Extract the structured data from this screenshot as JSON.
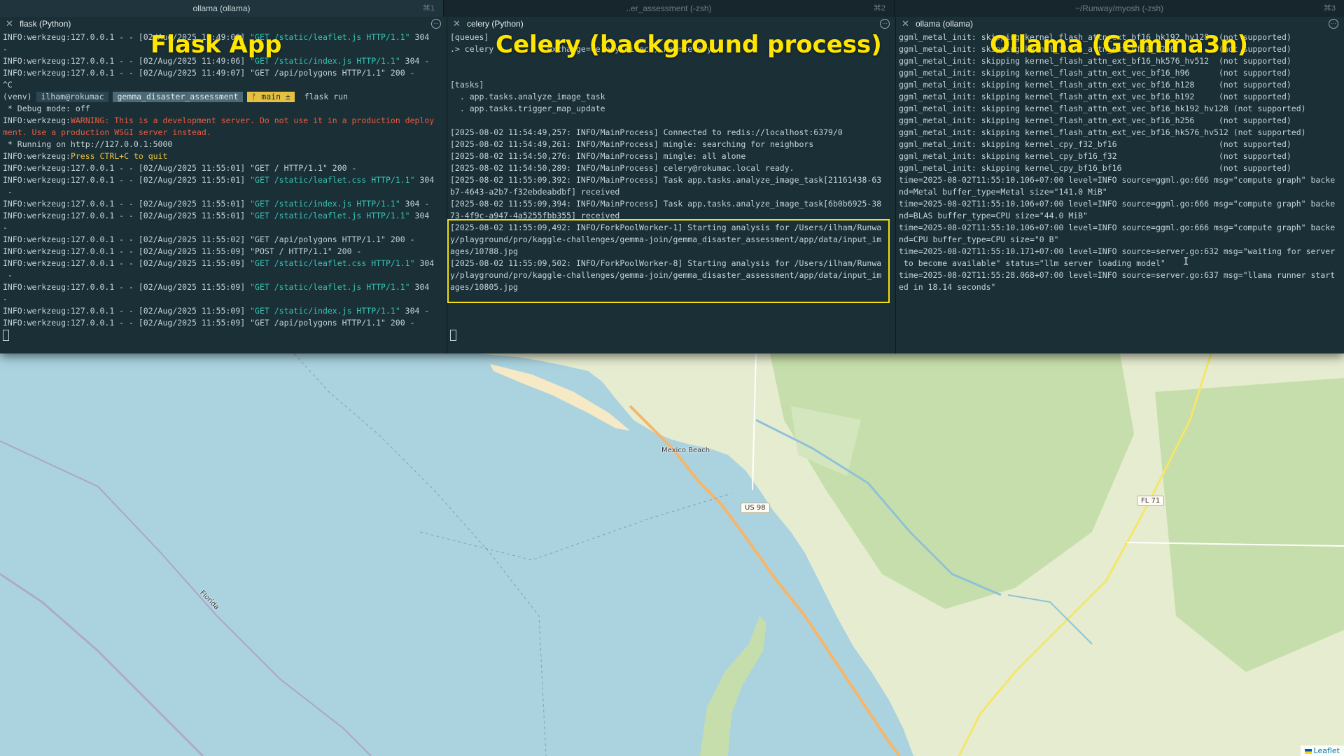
{
  "tabs": [
    {
      "title": "ollama (ollama)",
      "shortcut": "⌘1",
      "active": true
    },
    {
      "title": "..er_assessment (-zsh)",
      "shortcut": "⌘2",
      "active": false
    },
    {
      "title": "~/Runway/myosh (-zsh)",
      "shortcut": "⌘3",
      "active": false
    }
  ],
  "panes": {
    "flask": {
      "header": "flask (Python)",
      "overlay_title": "Flask App",
      "lines": [
        {
          "parts": [
            {
              "t": "INFO:werkzeug:127.0.0.1 - - [02/Aug/2025 11:49:06] "
            },
            {
              "t": "\"GET /static/leaflet.js HTTP/1.1\"",
              "c": "green"
            },
            {
              "t": " 304"
            }
          ]
        },
        {
          "parts": [
            {
              "t": "-"
            }
          ]
        },
        {
          "parts": [
            {
              "t": "INFO:werkzeug:127.0.0.1 - - [02/Aug/2025 11:49:06] "
            },
            {
              "t": "\"GET /static/index.js HTTP/1.1\"",
              "c": "green"
            },
            {
              "t": " 304 -"
            }
          ]
        },
        {
          "parts": [
            {
              "t": "INFO:werkzeug:127.0.0.1 - - [02/Aug/2025 11:49:07] \"GET /api/polygons HTTP/1.1\" 200 -"
            }
          ]
        },
        {
          "parts": [
            {
              "t": "^C"
            }
          ]
        },
        {
          "prompt": true
        },
        {
          "parts": [
            {
              "t": " * Debug mode: off"
            }
          ]
        },
        {
          "parts": [
            {
              "t": "INFO:werkzeug:"
            },
            {
              "t": "WARNING: This is a development server. Do not use it in a production deploy",
              "c": "red"
            }
          ]
        },
        {
          "parts": [
            {
              "t": "ment. Use a production WSGI server instead.",
              "c": "red"
            }
          ]
        },
        {
          "parts": [
            {
              "t": " * Running on http://127.0.0.1:5000"
            }
          ]
        },
        {
          "parts": [
            {
              "t": "INFO:werkzeug:"
            },
            {
              "t": "Press CTRL+C to quit",
              "c": "yellow"
            }
          ]
        },
        {
          "parts": [
            {
              "t": "INFO:werkzeug:127.0.0.1 - - [02/Aug/2025 11:55:01] \"GET / HTTP/1.1\" 200 -"
            }
          ]
        },
        {
          "parts": [
            {
              "t": "INFO:werkzeug:127.0.0.1 - - [02/Aug/2025 11:55:01] "
            },
            {
              "t": "\"GET /static/leaflet.css HTTP/1.1\"",
              "c": "green"
            },
            {
              "t": " 304"
            }
          ]
        },
        {
          "parts": [
            {
              "t": " -"
            }
          ]
        },
        {
          "parts": [
            {
              "t": "INFO:werkzeug:127.0.0.1 - - [02/Aug/2025 11:55:01] "
            },
            {
              "t": "\"GET /static/index.js HTTP/1.1\"",
              "c": "green"
            },
            {
              "t": " 304 -"
            }
          ]
        },
        {
          "parts": [
            {
              "t": "INFO:werkzeug:127.0.0.1 - - [02/Aug/2025 11:55:01] "
            },
            {
              "t": "\"GET /static/leaflet.js HTTP/1.1\"",
              "c": "green"
            },
            {
              "t": " 304"
            }
          ]
        },
        {
          "parts": [
            {
              "t": "-"
            }
          ]
        },
        {
          "parts": [
            {
              "t": "INFO:werkzeug:127.0.0.1 - - [02/Aug/2025 11:55:02] \"GET /api/polygons HTTP/1.1\" 200 -"
            }
          ]
        },
        {
          "parts": [
            {
              "t": "INFO:werkzeug:127.0.0.1 - - [02/Aug/2025 11:55:09] \"POST / HTTP/1.1\" 200 -"
            }
          ]
        },
        {
          "parts": [
            {
              "t": "INFO:werkzeug:127.0.0.1 - - [02/Aug/2025 11:55:09] "
            },
            {
              "t": "\"GET /static/leaflet.css HTTP/1.1\"",
              "c": "green"
            },
            {
              "t": " 304"
            }
          ]
        },
        {
          "parts": [
            {
              "t": " -"
            }
          ]
        },
        {
          "parts": [
            {
              "t": "INFO:werkzeug:127.0.0.1 - - [02/Aug/2025 11:55:09] "
            },
            {
              "t": "\"GET /static/leaflet.js HTTP/1.1\"",
              "c": "green"
            },
            {
              "t": " 304"
            }
          ]
        },
        {
          "parts": [
            {
              "t": "-"
            }
          ]
        },
        {
          "parts": [
            {
              "t": "INFO:werkzeug:127.0.0.1 - - [02/Aug/2025 11:55:09] "
            },
            {
              "t": "\"GET /static/index.js HTTP/1.1\"",
              "c": "green"
            },
            {
              "t": " 304 -"
            }
          ]
        },
        {
          "parts": [
            {
              "t": "INFO:werkzeug:127.0.0.1 - - [02/Aug/2025 11:55:09] \"GET /api/polygons HTTP/1.1\" 200 -"
            }
          ]
        },
        {
          "cursor": true
        }
      ],
      "prompt": {
        "venv": "(venv)",
        "user": "ilham@rokumac",
        "dir": "gemma_disaster_assessment",
        "branch": "ᚠ main ±",
        "command": "flask run"
      }
    },
    "celery": {
      "header": "celery (Python)",
      "overlay_title": "Celery (background process)",
      "lines": [
        {
          "parts": [
            {
              "t": "[queues]"
            }
          ]
        },
        {
          "parts": [
            {
              "t": ".> celery           exchange=celery(direct) key=celery"
            }
          ]
        },
        {
          "parts": [
            {
              "t": ""
            }
          ]
        },
        {
          "parts": [
            {
              "t": ""
            }
          ]
        },
        {
          "parts": [
            {
              "t": "[tasks]"
            }
          ]
        },
        {
          "parts": [
            {
              "t": "  . app.tasks.analyze_image_task"
            }
          ]
        },
        {
          "parts": [
            {
              "t": "  . app.tasks.trigger_map_update"
            }
          ]
        },
        {
          "parts": [
            {
              "t": ""
            }
          ]
        },
        {
          "parts": [
            {
              "t": "[2025-08-02 11:54:49,257: INFO/MainProcess] Connected to redis://localhost:6379/0"
            }
          ]
        },
        {
          "parts": [
            {
              "t": "[2025-08-02 11:54:49,261: INFO/MainProcess] mingle: searching for neighbors"
            }
          ]
        },
        {
          "parts": [
            {
              "t": "[2025-08-02 11:54:50,276: INFO/MainProcess] mingle: all alone"
            }
          ]
        },
        {
          "parts": [
            {
              "t": "[2025-08-02 11:54:50,289: INFO/MainProcess] celery@rokumac.local ready."
            }
          ]
        },
        {
          "parts": [
            {
              "t": "[2025-08-02 11:55:09,392: INFO/MainProcess] Task app.tasks.analyze_image_task[21161438-63"
            }
          ]
        },
        {
          "parts": [
            {
              "t": "b7-4643-a2b7-f32ebdeabdbf] received"
            }
          ]
        },
        {
          "parts": [
            {
              "t": "[2025-08-02 11:55:09,394: INFO/MainProcess] Task app.tasks.analyze_image_task[6b0b6925-38"
            }
          ]
        },
        {
          "parts": [
            {
              "t": "73-4f9c-a947-4a5255fbb355] received"
            }
          ]
        },
        {
          "parts": [
            {
              "t": "[2025-08-02 11:55:09,492: INFO/ForkPoolWorker-1] Starting analysis for /Users/ilham/Runwa"
            }
          ]
        },
        {
          "parts": [
            {
              "t": "y/playground/pro/kaggle-challenges/gemma-join/gemma_disaster_assessment/app/data/input_im"
            }
          ]
        },
        {
          "parts": [
            {
              "t": "ages/10788.jpg"
            }
          ]
        },
        {
          "parts": [
            {
              "t": "[2025-08-02 11:55:09,502: INFO/ForkPoolWorker-8] Starting analysis for /Users/ilham/Runwa"
            }
          ]
        },
        {
          "parts": [
            {
              "t": "y/playground/pro/kaggle-challenges/gemma-join/gemma_disaster_assessment/app/data/input_im"
            }
          ]
        },
        {
          "parts": [
            {
              "t": "ages/10805.jpg"
            }
          ]
        },
        {
          "parts": [
            {
              "t": ""
            }
          ]
        },
        {
          "parts": [
            {
              "t": ""
            }
          ]
        },
        {
          "parts": [
            {
              "t": ""
            }
          ]
        },
        {
          "cursor": true
        }
      ]
    },
    "ollama": {
      "header": "ollama (ollama)",
      "overlay_title": "Ollama (Gemma3n)",
      "lines": [
        {
          "parts": [
            {
              "t": "ggml_metal_init: skipping kernel_flash_attn_ext_bf16_hk192_hv128  (not supported)"
            }
          ]
        },
        {
          "parts": [
            {
              "t": "ggml_metal_init: skipping kernel_flash_attn_ext_bf16_h256         (not supported)"
            }
          ]
        },
        {
          "parts": [
            {
              "t": "ggml_metal_init: skipping kernel_flash_attn_ext_bf16_hk576_hv512  (not supported)"
            }
          ]
        },
        {
          "parts": [
            {
              "t": "ggml_metal_init: skipping kernel_flash_attn_ext_vec_bf16_h96      (not supported)"
            }
          ]
        },
        {
          "parts": [
            {
              "t": "ggml_metal_init: skipping kernel_flash_attn_ext_vec_bf16_h128     (not supported)"
            }
          ]
        },
        {
          "parts": [
            {
              "t": "ggml_metal_init: skipping kernel_flash_attn_ext_vec_bf16_h192     (not supported)"
            }
          ]
        },
        {
          "parts": [
            {
              "t": "ggml_metal_init: skipping kernel_flash_attn_ext_vec_bf16_hk192_hv128 (not supported)"
            }
          ]
        },
        {
          "parts": [
            {
              "t": "ggml_metal_init: skipping kernel_flash_attn_ext_vec_bf16_h256     (not supported)"
            }
          ]
        },
        {
          "parts": [
            {
              "t": "ggml_metal_init: skipping kernel_flash_attn_ext_vec_bf16_hk576_hv512 (not supported)"
            }
          ]
        },
        {
          "parts": [
            {
              "t": "ggml_metal_init: skipping kernel_cpy_f32_bf16                     (not supported)"
            }
          ]
        },
        {
          "parts": [
            {
              "t": "ggml_metal_init: skipping kernel_cpy_bf16_f32                     (not supported)"
            }
          ]
        },
        {
          "parts": [
            {
              "t": "ggml_metal_init: skipping kernel_cpy_bf16_bf16                    (not supported)"
            }
          ]
        },
        {
          "parts": [
            {
              "t": "time=2025-08-02T11:55:10.106+07:00 level=INFO source=ggml.go:666 msg=\"compute graph\" backe"
            }
          ]
        },
        {
          "parts": [
            {
              "t": "nd=Metal buffer_type=Metal size=\"141.0 MiB\""
            }
          ]
        },
        {
          "parts": [
            {
              "t": "time=2025-08-02T11:55:10.106+07:00 level=INFO source=ggml.go:666 msg=\"compute graph\" backe"
            }
          ]
        },
        {
          "parts": [
            {
              "t": "nd=BLAS buffer_type=CPU size=\"44.0 MiB\""
            }
          ]
        },
        {
          "parts": [
            {
              "t": "time=2025-08-02T11:55:10.106+07:00 level=INFO source=ggml.go:666 msg=\"compute graph\" backe"
            }
          ]
        },
        {
          "parts": [
            {
              "t": "nd=CPU buffer_type=CPU size=\"0 B\""
            }
          ]
        },
        {
          "parts": [
            {
              "t": "time=2025-08-02T11:55:10.171+07:00 level=INFO source=server.go:632 msg=\"waiting for server"
            }
          ]
        },
        {
          "parts": [
            {
              "t": " to become available\" status=\"llm server loading model\""
            }
          ]
        },
        {
          "parts": [
            {
              "t": "time=2025-08-02T11:55:28.068+07:00 level=INFO source=server.go:637 msg=\"llama runner start"
            }
          ]
        },
        {
          "parts": [
            {
              "t": "ed in 18.14 seconds\""
            }
          ]
        }
      ]
    }
  },
  "map": {
    "labels": {
      "mexico_beach": "Mexico Beach",
      "florida": "Florida",
      "us98": "US 98",
      "fl71": "FL 71"
    },
    "attribution": "Leaflet"
  },
  "colors": {
    "terminal_bg": "#1b2f37",
    "highlight": "#f4e10f",
    "overlay_text": "#ffe600",
    "water": "#aad3df",
    "land": "#e6eccf",
    "forest": "#c6deab"
  }
}
